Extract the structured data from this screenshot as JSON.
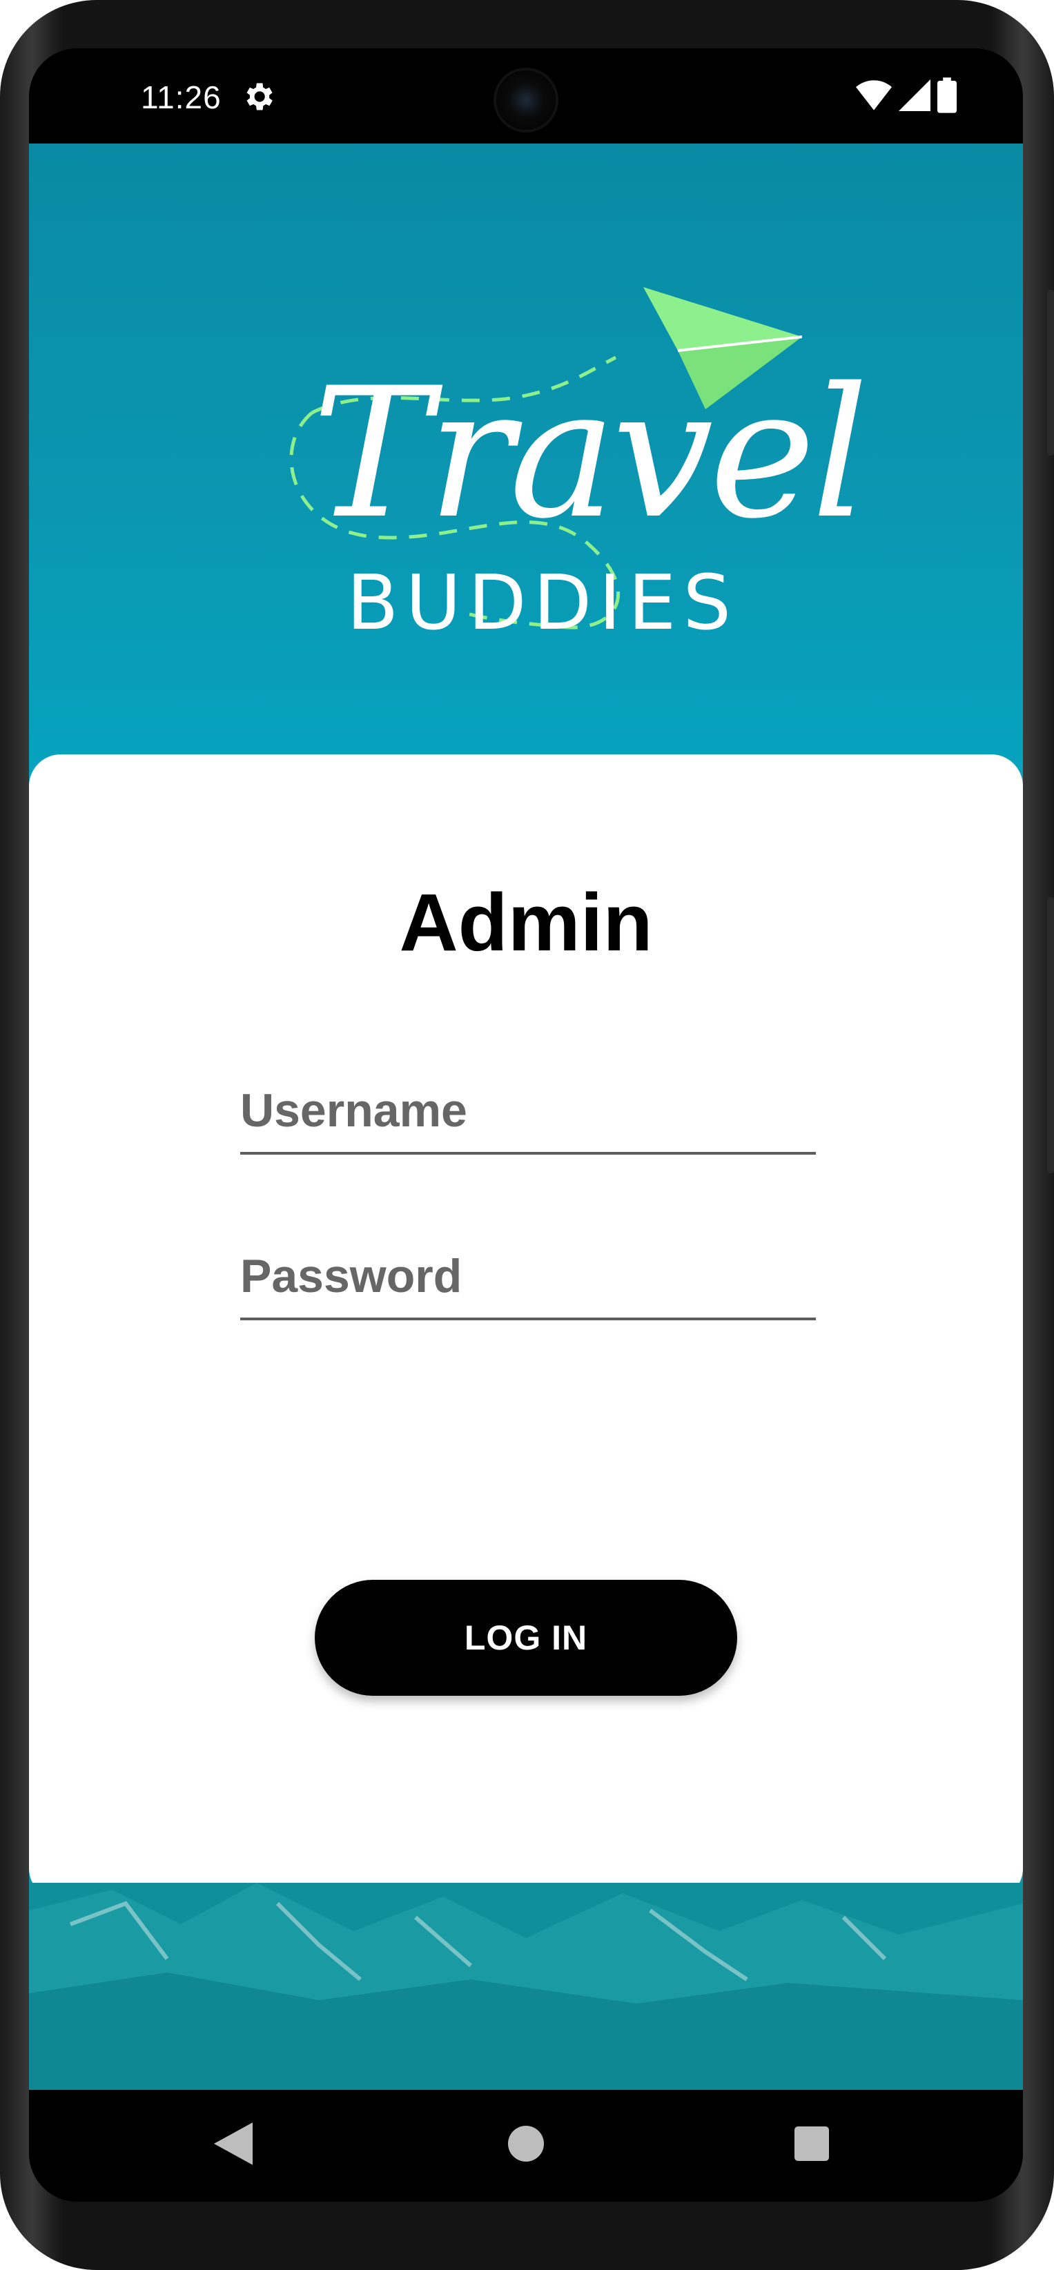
{
  "status_bar": {
    "time": "11:26",
    "icons": [
      "gear-icon",
      "wifi-icon",
      "cellular-signal-icon",
      "battery-icon"
    ]
  },
  "logo": {
    "title": "Travel",
    "subtitle": "BUDDIES",
    "accent_color": "#8ef08c"
  },
  "login": {
    "title": "Admin",
    "username_placeholder": "Username",
    "password_placeholder": "Password",
    "button_label": "LOG IN"
  },
  "nav_bar": {
    "icons": [
      "back-icon",
      "home-icon",
      "recents-icon"
    ]
  },
  "colors": {
    "background_teal": "#03a9c5",
    "card": "#ffffff",
    "button": "#000000"
  }
}
